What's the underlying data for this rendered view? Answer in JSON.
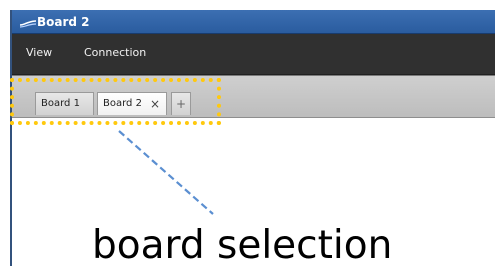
{
  "window": {
    "title": "Board 2",
    "app_icon": "wave-icon"
  },
  "menu": {
    "items": [
      "View",
      "Connection"
    ]
  },
  "tabs": {
    "items": [
      {
        "label": "Board 1"
      },
      {
        "label": "Board 2",
        "close_icon": "×"
      },
      {
        "label": "+"
      }
    ],
    "selected_index": 1
  },
  "annotation": {
    "caption": "board selection",
    "highlight_color": "#ffc90e",
    "line_color": "#5b8fd1"
  }
}
